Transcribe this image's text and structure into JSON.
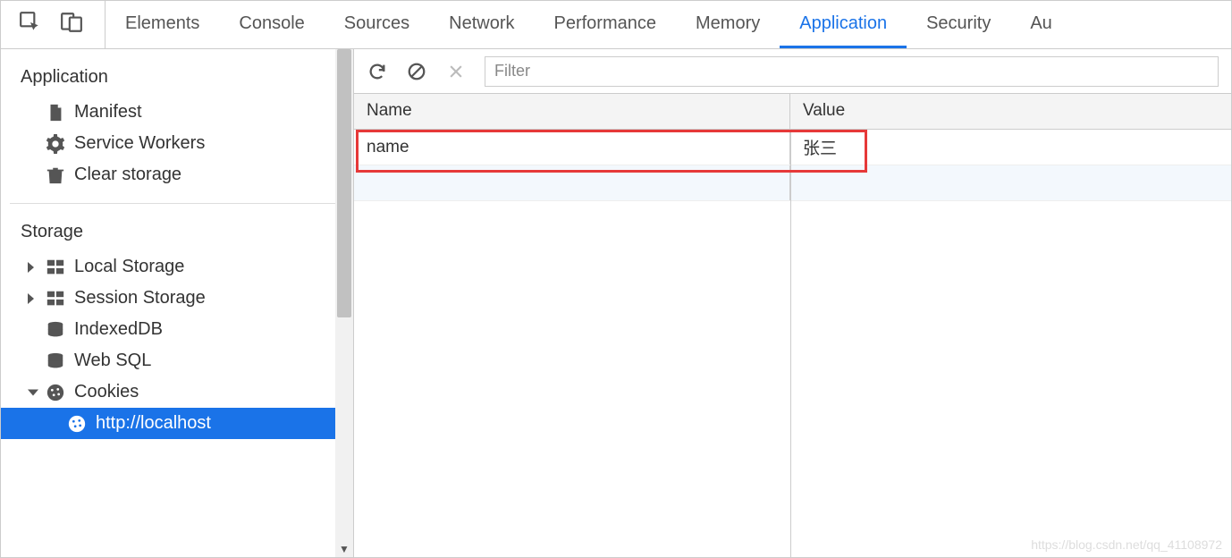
{
  "tabs": {
    "items": [
      "Elements",
      "Console",
      "Sources",
      "Network",
      "Performance",
      "Memory",
      "Application",
      "Security",
      "Au"
    ],
    "active_index": 6
  },
  "sidebar": {
    "application_section": {
      "title": "Application",
      "items": [
        {
          "label": "Manifest",
          "icon": "file-icon"
        },
        {
          "label": "Service Workers",
          "icon": "gear-icon"
        },
        {
          "label": "Clear storage",
          "icon": "trash-icon"
        }
      ]
    },
    "storage_section": {
      "title": "Storage",
      "items": [
        {
          "label": "Local Storage",
          "icon": "grid-icon",
          "caret": "right"
        },
        {
          "label": "Session Storage",
          "icon": "grid-icon",
          "caret": "right"
        },
        {
          "label": "IndexedDB",
          "icon": "db-icon"
        },
        {
          "label": "Web SQL",
          "icon": "db-icon"
        },
        {
          "label": "Cookies",
          "icon": "cookie-icon",
          "caret": "down",
          "children": [
            {
              "label": "http://localhost",
              "icon": "cookie-icon",
              "selected": true
            }
          ]
        }
      ]
    }
  },
  "toolbar": {
    "filter_placeholder": "Filter"
  },
  "table": {
    "columns": {
      "name": "Name",
      "value": "Value"
    },
    "rows": [
      {
        "name": "name",
        "value": "张三"
      }
    ]
  },
  "watermark": "https://blog.csdn.net/qq_41108972"
}
